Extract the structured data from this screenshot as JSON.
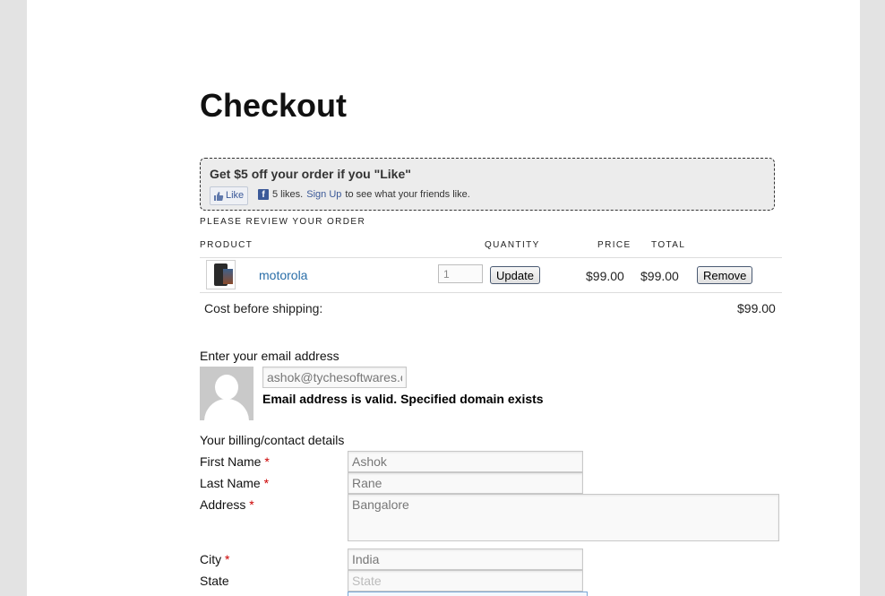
{
  "page": {
    "title": "Checkout"
  },
  "promo": {
    "headline": "Get $5 off your order if you \"Like\"",
    "like_label": "Like",
    "likes_text": "5 likes.",
    "signup_label": "Sign Up",
    "signup_suffix": "to see what your friends like."
  },
  "review": {
    "heading": "PLEASE REVIEW YOUR ORDER",
    "columns": {
      "product": "PRODUCT",
      "quantity": "QUANTITY",
      "price": "PRICE",
      "total": "TOTAL"
    },
    "items": [
      {
        "name": "motorola",
        "quantity": "1",
        "update_label": "Update",
        "price": "$99.00",
        "total": "$99.00",
        "remove_label": "Remove"
      }
    ],
    "subtotal_label": "Cost before shipping:",
    "subtotal_value": "$99.00"
  },
  "email": {
    "label": "Enter your email address",
    "value": "ashok@tychesoftwares.com",
    "validation": "Email address is valid. Specified domain exists"
  },
  "billing": {
    "heading": "Your billing/contact details",
    "required_marker": "*",
    "first_name": {
      "label": "First Name",
      "value": "Ashok"
    },
    "last_name": {
      "label": "Last Name",
      "value": "Rane"
    },
    "address": {
      "label": "Address",
      "value": "Bangalore"
    },
    "city": {
      "label": "City",
      "value": "India"
    },
    "state": {
      "label": "State",
      "placeholder": "State"
    }
  },
  "colors": {
    "link": "#2a6ea8",
    "required": "#cc0000",
    "facebook": "#3b5998"
  }
}
